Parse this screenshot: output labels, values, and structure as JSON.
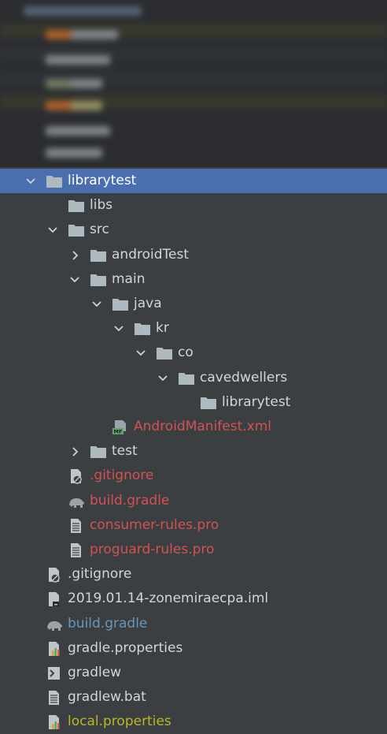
{
  "tree": {
    "items": [
      {
        "label": "librarytest",
        "color": "white",
        "icon": "folder-icon",
        "arrow": "expanded",
        "selected": true
      },
      {
        "label": "libs",
        "color": "default",
        "icon": "folder-icon",
        "arrow": "none"
      },
      {
        "label": "src",
        "color": "default",
        "icon": "folder-icon",
        "arrow": "expanded"
      },
      {
        "label": "androidTest",
        "color": "default",
        "icon": "folder-icon",
        "arrow": "collapsed"
      },
      {
        "label": "main",
        "color": "default",
        "icon": "folder-icon",
        "arrow": "expanded"
      },
      {
        "label": "java",
        "color": "default",
        "icon": "folder-icon",
        "arrow": "expanded"
      },
      {
        "label": "kr",
        "color": "default",
        "icon": "folder-icon",
        "arrow": "expanded"
      },
      {
        "label": "co",
        "color": "default",
        "icon": "folder-icon",
        "arrow": "expanded"
      },
      {
        "label": "cavedwellers",
        "color": "default",
        "icon": "folder-icon",
        "arrow": "expanded"
      },
      {
        "label": "librarytest",
        "color": "default",
        "icon": "folder-icon",
        "arrow": "none"
      },
      {
        "label": "AndroidManifest.xml",
        "color": "red",
        "icon": "manifest-file-icon",
        "arrow": "none"
      },
      {
        "label": "test",
        "color": "default",
        "icon": "folder-icon",
        "arrow": "collapsed"
      },
      {
        "label": ".gitignore",
        "color": "red",
        "icon": "ignore-file-icon",
        "arrow": "none"
      },
      {
        "label": "build.gradle",
        "color": "red",
        "icon": "gradle-elephant-icon",
        "arrow": "none"
      },
      {
        "label": "consumer-rules.pro",
        "color": "red",
        "icon": "text-file-icon",
        "arrow": "none"
      },
      {
        "label": "proguard-rules.pro",
        "color": "red",
        "icon": "text-file-icon",
        "arrow": "none"
      },
      {
        "label": ".gitignore",
        "color": "default",
        "icon": "ignore-file-icon",
        "arrow": "none"
      },
      {
        "label": "2019.01.14-zonemiraecpa.iml",
        "color": "default",
        "icon": "iml-file-icon",
        "arrow": "none"
      },
      {
        "label": "build.gradle",
        "color": "blue",
        "icon": "gradle-elephant-icon",
        "arrow": "none"
      },
      {
        "label": "gradle.properties",
        "color": "default",
        "icon": "properties-file-icon",
        "arrow": "none"
      },
      {
        "label": "gradlew",
        "color": "default",
        "icon": "shell-script-icon",
        "arrow": "none"
      },
      {
        "label": "gradlew.bat",
        "color": "default",
        "icon": "text-file-icon",
        "arrow": "none"
      },
      {
        "label": "local.properties",
        "color": "yellow",
        "icon": "properties-file-icon",
        "arrow": "none"
      }
    ]
  },
  "colors": {
    "panel_bg": "#3c3f41",
    "selection": "#4b6eaf",
    "default_text": "#d5d5d5",
    "modified_red": "#d25252",
    "modified_blue": "#6897bb",
    "ignored_yellow": "#bbb529",
    "folder": "#aeb9c0"
  }
}
